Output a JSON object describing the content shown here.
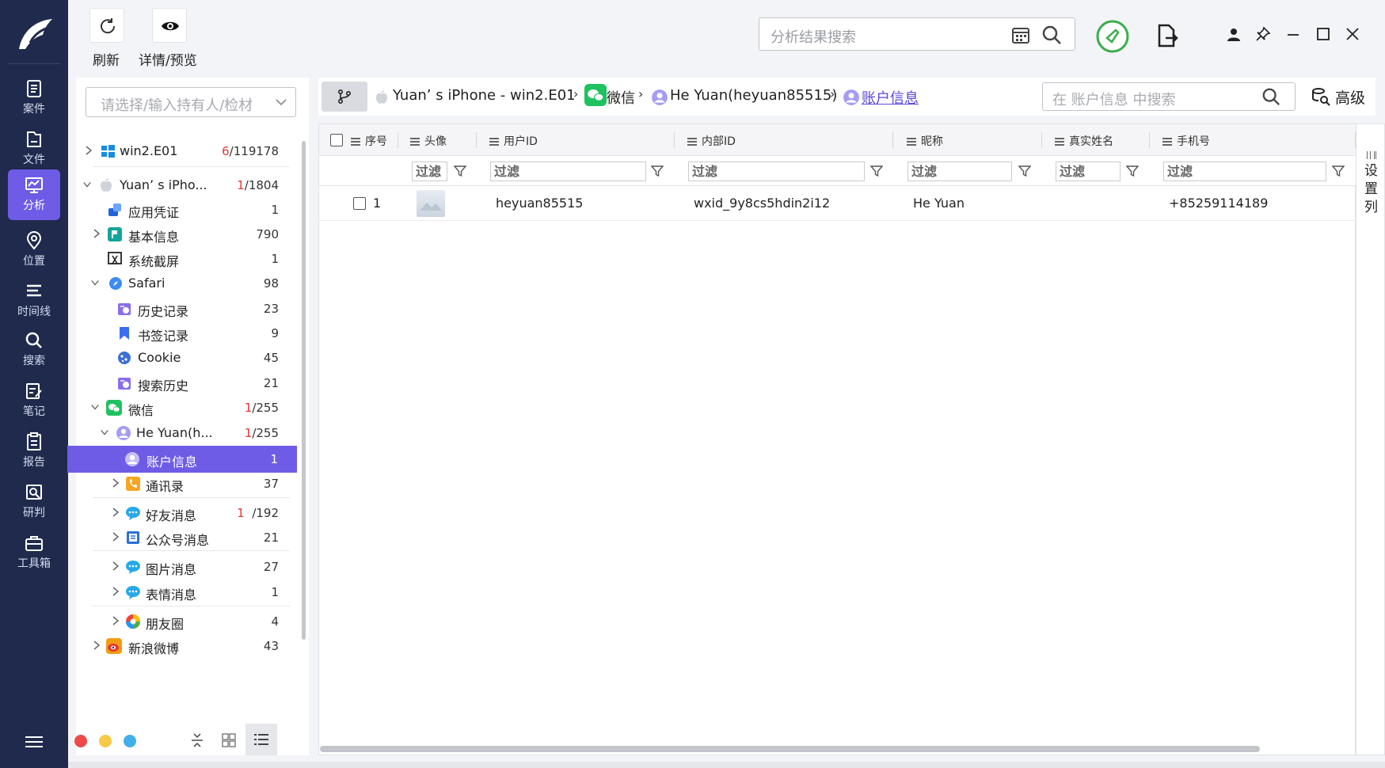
{
  "toolbar": {
    "refresh_label": "刷新",
    "details_label": "详情/预览",
    "search_placeholder": "分析结果搜索"
  },
  "nav": {
    "items": [
      {
        "label": "案件",
        "icon": "case-icon"
      },
      {
        "label": "文件",
        "icon": "file-icon"
      },
      {
        "label": "分析",
        "icon": "analysis-icon",
        "active": true
      },
      {
        "label": "位置",
        "icon": "location-icon"
      },
      {
        "label": "时间线",
        "icon": "timeline-icon"
      },
      {
        "label": "搜索",
        "icon": "search-icon"
      },
      {
        "label": "笔记",
        "icon": "notes-icon"
      },
      {
        "label": "报告",
        "icon": "report-icon"
      },
      {
        "label": "研判",
        "icon": "judgement-icon"
      },
      {
        "label": "工具箱",
        "icon": "toolbox-icon"
      }
    ],
    "accent": "#6f5ce6"
  },
  "tree": {
    "holder_placeholder": "请选择/输入持有人/检材",
    "rows": [
      {
        "label": "win2.E01",
        "count_red": "6",
        "count": "/119178"
      },
      {
        "label": "Yuan’ s iPho...",
        "count_red": "1",
        "count": "/1804"
      },
      {
        "label": "应用凭证",
        "count": "1"
      },
      {
        "label": "基本信息",
        "count": "790"
      },
      {
        "label": "系统截屏",
        "count": "1"
      },
      {
        "label": "Safari",
        "count": "98"
      },
      {
        "label": "历史记录",
        "count": "23"
      },
      {
        "label": "书签记录",
        "count": "9"
      },
      {
        "label": "Cookie",
        "count": "45"
      },
      {
        "label": "搜索历史",
        "count": "21"
      },
      {
        "label": "微信",
        "count_red": "1",
        "count": "/255"
      },
      {
        "label": "He Yuan(h...",
        "count_red": "1",
        "count": "/255"
      },
      {
        "label": "账户信息",
        "count": "1"
      },
      {
        "label": "通讯录",
        "count": "37"
      },
      {
        "label": "好友消息",
        "count_red": "1",
        "count": "/192"
      },
      {
        "label": "公众号消息",
        "count": "21"
      },
      {
        "label": "图片消息",
        "count": "27"
      },
      {
        "label": "表情消息",
        "count": "1"
      },
      {
        "label": "朋友圈",
        "count": "4"
      },
      {
        "label": "新浪微博",
        "count": "43"
      }
    ]
  },
  "breadcrumb": {
    "device": "Yuan’ s iPhone - win2.E01",
    "app": "微信",
    "account": "He Yuan(heyuan85515)",
    "current": "账户信息",
    "search_placeholder": "在 账户信息 中搜索",
    "advanced_label": "高级"
  },
  "grid": {
    "columns": [
      "序号",
      "头像",
      "用户ID",
      "内部ID",
      "昵称",
      "真实姓名",
      "手机号"
    ],
    "filter_placeholder": "过滤",
    "rows": [
      {
        "index": "1",
        "user_id": "heyuan85515",
        "internal_id": "wxid_9y8cs5hdin2i12",
        "nickname": "He Yuan",
        "real_name": "",
        "phone": "+85259114189"
      }
    ],
    "settings_label": "设置列"
  }
}
